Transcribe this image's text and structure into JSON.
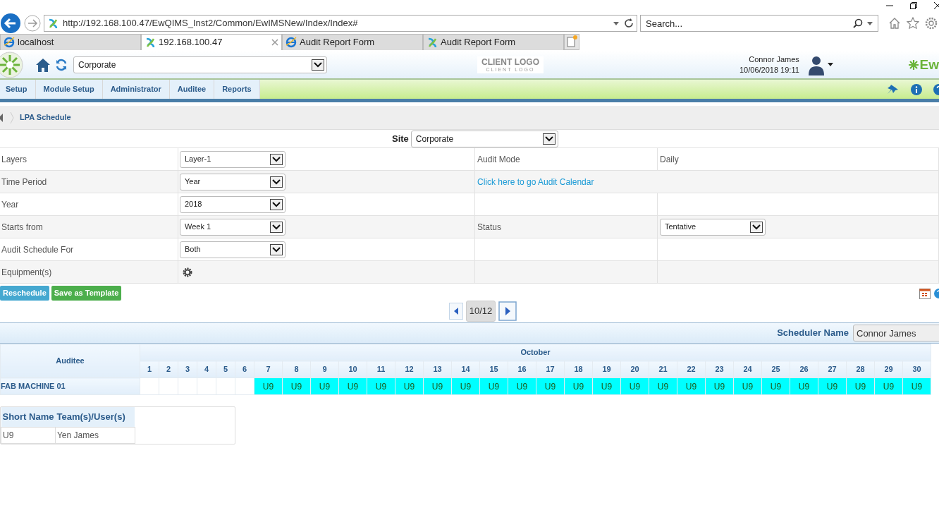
{
  "browser": {
    "url": "http://192.168.100.47/EwQIMS_Inst2/Common/EwIMSNew/Index/Index#",
    "search_placeholder": "Search...",
    "tabs": [
      {
        "title": "localhost",
        "selected": false,
        "kind": "ie"
      },
      {
        "title": "192.168.100.47",
        "selected": true,
        "kind": "app"
      },
      {
        "title": "Audit Report Form",
        "selected": false,
        "kind": "ie"
      },
      {
        "title": "Audit Report Form",
        "selected": false,
        "kind": "app"
      }
    ]
  },
  "header": {
    "site": "Corporate",
    "client_logo": "CLIENT LOGO",
    "client_logo_sub": "CLIENT LOGO",
    "user_name": "Connor James",
    "datetime": "10/06/2018 19:11",
    "brand": "Ew"
  },
  "menu": [
    "Setup",
    "Module Setup",
    "Administrator",
    "Auditee",
    "Reports"
  ],
  "breadcrumb": "LPA Schedule",
  "site": {
    "label": "Site",
    "value": "Corporate"
  },
  "form_rows": [
    {
      "label": "Layers",
      "kind": "select",
      "value": "Layer-1",
      "right_label": {
        "kind": "text",
        "text": "Audit Mode"
      },
      "right_value": {
        "kind": "text",
        "text": "Daily"
      }
    },
    {
      "label": "Time Period",
      "kind": "select",
      "value": "Year",
      "right_label": {
        "kind": "link",
        "text": "Click here to go Audit Calendar"
      }
    },
    {
      "label": "Year",
      "kind": "select",
      "value": "2018"
    },
    {
      "label": "Starts from",
      "kind": "select",
      "value": "Week 1",
      "right_label": {
        "kind": "text",
        "text": "Status"
      },
      "right_value": {
        "kind": "select",
        "text": "Tentative"
      }
    },
    {
      "label": "Audit Schedule For",
      "kind": "select",
      "value": "Both"
    },
    {
      "label": "Equipment(s)",
      "kind": "icon"
    }
  ],
  "buttons": [
    {
      "label": "Reschedule",
      "kind": "info"
    },
    {
      "label": "Save as Template",
      "kind": "success"
    }
  ],
  "pager": "10/12",
  "scheduler": {
    "label": "Scheduler Name",
    "value": "Connor James"
  },
  "calendar": {
    "auditee_header": "Auditee",
    "month": "October",
    "days": [
      "1",
      "2",
      "3",
      "4",
      "5",
      "6",
      "7",
      "8",
      "9",
      "10",
      "11",
      "12",
      "13",
      "14",
      "15",
      "16",
      "17",
      "18",
      "19",
      "20",
      "21",
      "22",
      "23",
      "24",
      "25",
      "26",
      "27",
      "28",
      "29",
      "30"
    ],
    "rows": [
      {
        "name": "FAB MACHINE 01",
        "cells": [
          {
            "text": "",
            "scheduled": false
          },
          {
            "text": "",
            "scheduled": false
          },
          {
            "text": "",
            "scheduled": false
          },
          {
            "text": "",
            "scheduled": false
          },
          {
            "text": "",
            "scheduled": false
          },
          {
            "text": "",
            "scheduled": false
          },
          {
            "text": "U9",
            "scheduled": true
          },
          {
            "text": "U9",
            "scheduled": true
          },
          {
            "text": "U9",
            "scheduled": true
          },
          {
            "text": "U9",
            "scheduled": true
          },
          {
            "text": "U9",
            "scheduled": true
          },
          {
            "text": "U9",
            "scheduled": true
          },
          {
            "text": "U9",
            "scheduled": true
          },
          {
            "text": "U9",
            "scheduled": true
          },
          {
            "text": "U9",
            "scheduled": true
          },
          {
            "text": "U9",
            "scheduled": true
          },
          {
            "text": "U9",
            "scheduled": true
          },
          {
            "text": "U9",
            "scheduled": true
          },
          {
            "text": "U9",
            "scheduled": true
          },
          {
            "text": "U9",
            "scheduled": true
          },
          {
            "text": "U9",
            "scheduled": true
          },
          {
            "text": "U9",
            "scheduled": true
          },
          {
            "text": "U9",
            "scheduled": true
          },
          {
            "text": "U9",
            "scheduled": true
          },
          {
            "text": "U9",
            "scheduled": true
          },
          {
            "text": "U9",
            "scheduled": true
          },
          {
            "text": "U9",
            "scheduled": true
          },
          {
            "text": "U9",
            "scheduled": true
          },
          {
            "text": "U9",
            "scheduled": true
          },
          {
            "text": "U9",
            "scheduled": true
          }
        ]
      }
    ]
  },
  "legend": {
    "columns": [
      "Short Name",
      "Team(s)/User(s)"
    ],
    "rows": [
      [
        "U9",
        "Yen James"
      ]
    ]
  }
}
